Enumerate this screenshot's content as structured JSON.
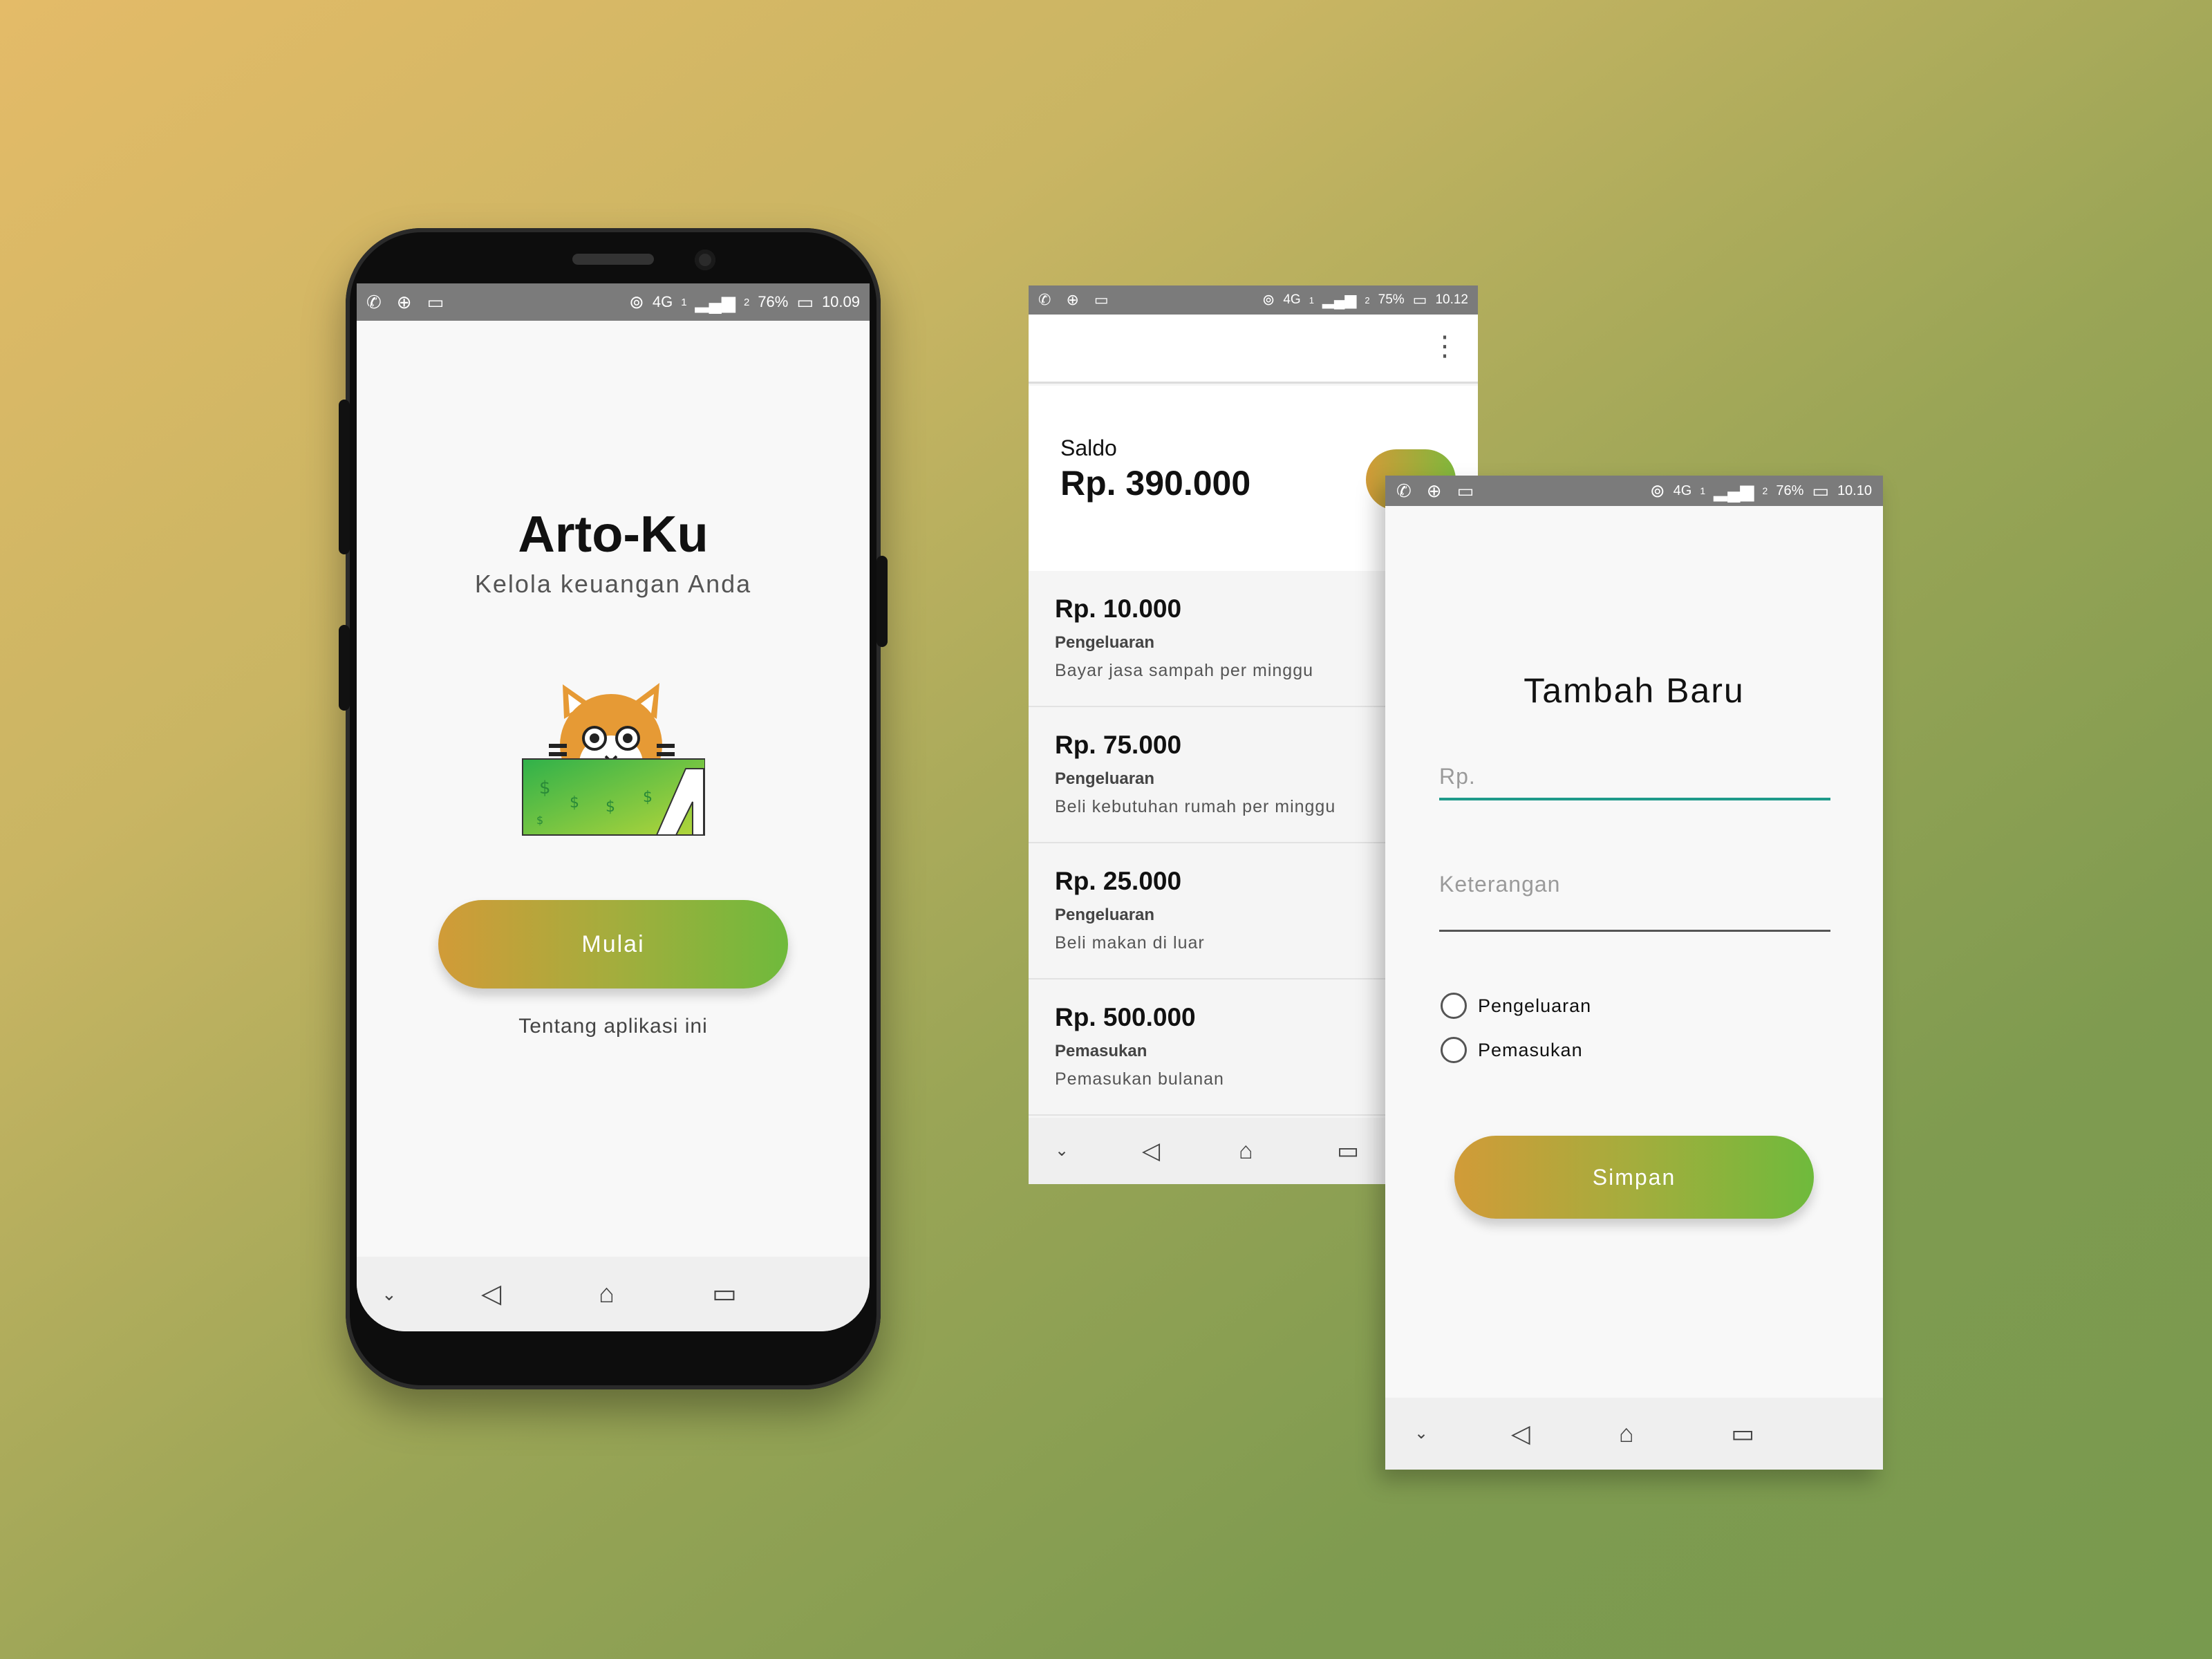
{
  "colors": {
    "accent_start": "#d19b38",
    "accent_end": "#6fba3c",
    "status_bar": "#7b7b7b",
    "input_underline_active": "#1f9a8a"
  },
  "status_bars": {
    "welcome": {
      "network": "4G",
      "sim": "1",
      "signal2": "2",
      "battery": "76%",
      "time": "10.09"
    },
    "list": {
      "network": "4G",
      "sim": "1",
      "signal2": "2",
      "battery": "75%",
      "time": "10.12"
    },
    "form": {
      "network": "4G",
      "sim": "1",
      "signal2": "2",
      "battery": "76%",
      "time": "10.10"
    }
  },
  "welcome": {
    "title": "Arto-Ku",
    "subtitle": "Kelola keuangan Anda",
    "start_button": "Mulai",
    "about_link": "Tentang aplikasi ini"
  },
  "transactions": {
    "balance_label": "Saldo",
    "balance_value": "Rp. 390.000",
    "items": [
      {
        "amount": "Rp. 10.000",
        "type": "Pengeluaran",
        "description": "Bayar jasa sampah per minggu"
      },
      {
        "amount": "Rp. 75.000",
        "type": "Pengeluaran",
        "description": "Beli kebutuhan rumah per minggu"
      },
      {
        "amount": "Rp. 25.000",
        "type": "Pengeluaran",
        "description": "Beli makan di luar"
      },
      {
        "amount": "Rp. 500.000",
        "type": "Pemasukan",
        "description": "Pemasukan bulanan"
      }
    ]
  },
  "add_form": {
    "title": "Tambah Baru",
    "amount_placeholder": "Rp.",
    "description_placeholder": "Keterangan",
    "radio_expense": "Pengeluaran",
    "radio_income": "Pemasukan",
    "save_button": "Simpan"
  },
  "icons": {
    "whatsapp": "whatsapp-icon",
    "download": "download-notification-icon",
    "image": "image-notification-icon",
    "more": "more-vert-icon",
    "nav_hide": "nav-hide-icon",
    "nav_back": "nav-back-icon",
    "nav_home": "nav-home-icon",
    "nav_recents": "nav-recents-icon"
  }
}
